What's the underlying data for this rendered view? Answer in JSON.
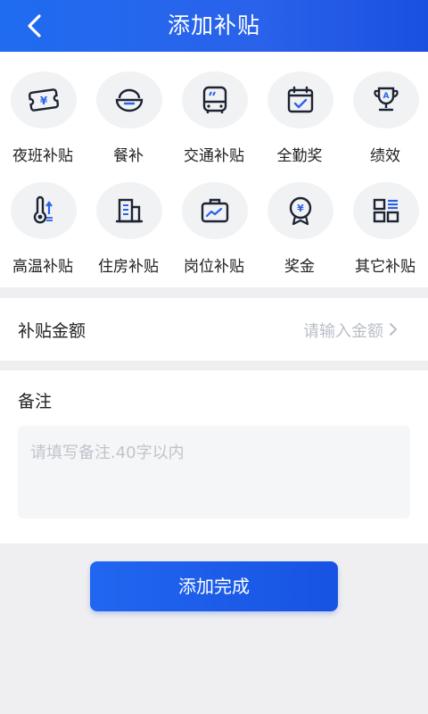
{
  "header": {
    "title": "添加补贴"
  },
  "categories": [
    {
      "label": "夜班补贴",
      "icon": "ticket-yen-icon"
    },
    {
      "label": "餐补",
      "icon": "rice-bowl-icon"
    },
    {
      "label": "交通补贴",
      "icon": "bus-icon"
    },
    {
      "label": "全勤奖",
      "icon": "calendar-check-icon"
    },
    {
      "label": "绩效",
      "icon": "trophy-icon"
    },
    {
      "label": "高温补贴",
      "icon": "thermometer-icon"
    },
    {
      "label": "住房补贴",
      "icon": "building-icon"
    },
    {
      "label": "岗位补贴",
      "icon": "briefcase-icon"
    },
    {
      "label": "奖金",
      "icon": "medal-yen-icon"
    },
    {
      "label": "其它补贴",
      "icon": "grid-list-icon"
    }
  ],
  "amount": {
    "label": "补贴金额",
    "placeholder": "请输入金额"
  },
  "note": {
    "label": "备注",
    "placeholder": "请填写备注.40字以内"
  },
  "submit": {
    "label": "添加完成"
  },
  "colors": {
    "accent": "#1f6cf0",
    "icon_stroke": "#1c2333",
    "icon_accent": "#2a62ea"
  }
}
